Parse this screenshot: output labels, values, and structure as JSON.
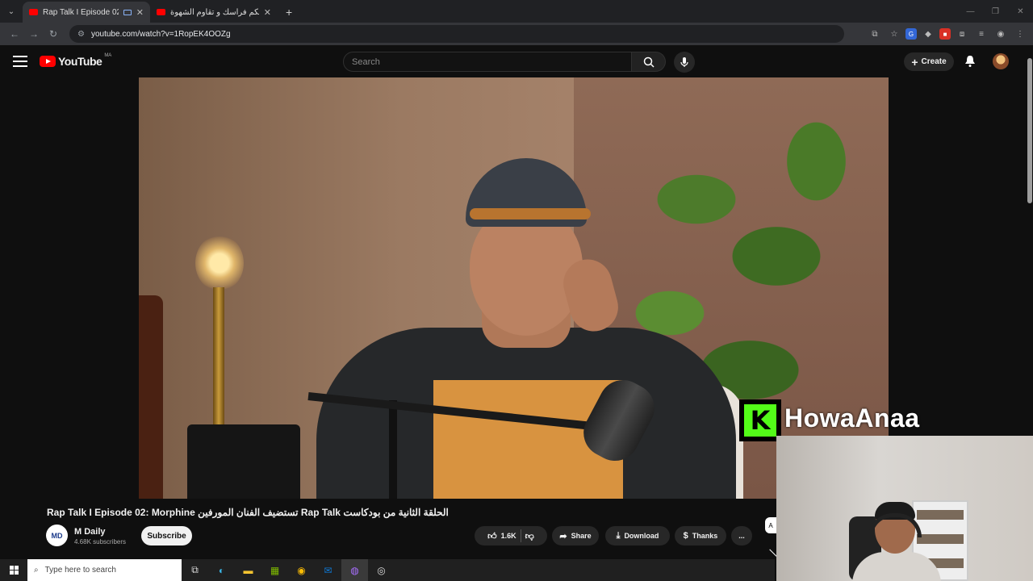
{
  "browser": {
    "tabs": [
      {
        "title": "Rap Talk I Episode 02: Morphine"
      },
      {
        "title": "كيفاش تحكم فراسك و تقاوم الشهوة"
      }
    ],
    "url": "youtube.com/watch?v=1RopEK4OOZg"
  },
  "youtube": {
    "logo_text": "YouTube",
    "country_code": "MA",
    "search_placeholder": "Search",
    "create_label": "Create"
  },
  "video": {
    "title": "Rap Talk I Episode 02: Morphine تستضيف الفنان المورفين Rap Talk الحلقة الثانية من بودكاست",
    "channel_name": "M Daily",
    "channel_subs": "4.68K subscribers",
    "channel_avatar_text": "MD",
    "subscribe_label": "Subscribe",
    "likes": "1.6K",
    "share_label": "Share",
    "download_label": "Download",
    "thanks_label": "Thanks",
    "more_label": "..."
  },
  "overlay": {
    "kick_letter": "K",
    "streamer_name": "HowaAnaa",
    "side_badge": "A"
  },
  "taskbar": {
    "search_placeholder": "Type here to search"
  }
}
